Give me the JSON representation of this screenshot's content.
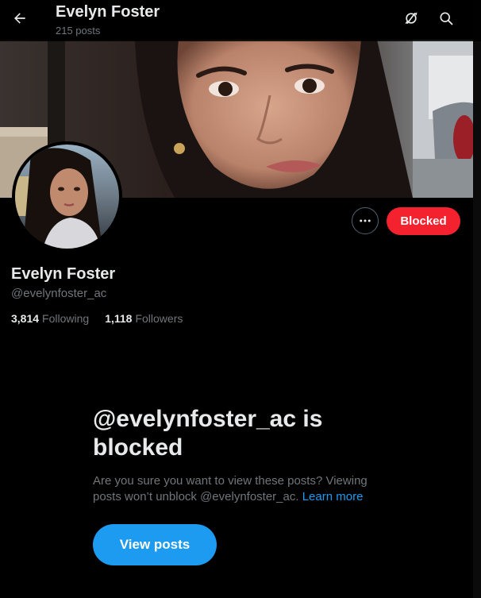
{
  "header": {
    "title": "Evelyn Foster",
    "post_count": "215 posts",
    "back_icon": "back-arrow-icon",
    "refresh_icon": "refresh-icon",
    "search_icon": "search-icon"
  },
  "profile": {
    "display_name": "Evelyn Foster",
    "handle": "@evelynfoster_ac",
    "following_count": "3,814",
    "following_label": "Following",
    "followers_count": "1,118",
    "followers_label": "Followers"
  },
  "actions": {
    "more_icon": "more-dots-icon",
    "blocked_label": "Blocked"
  },
  "blocked_notice": {
    "heading": "@evelynfoster_ac is blocked",
    "description": "Are you sure you want to view these posts? Viewing posts won’t unblock @evelynfoster_ac.",
    "learn_more": "Learn more",
    "view_posts_label": "View posts"
  },
  "colors": {
    "background": "#000000",
    "primary_text": "#e7e9ea",
    "secondary_text": "#71767b",
    "blocked_red": "#f4212e",
    "accent_blue": "#1d9bf0"
  }
}
